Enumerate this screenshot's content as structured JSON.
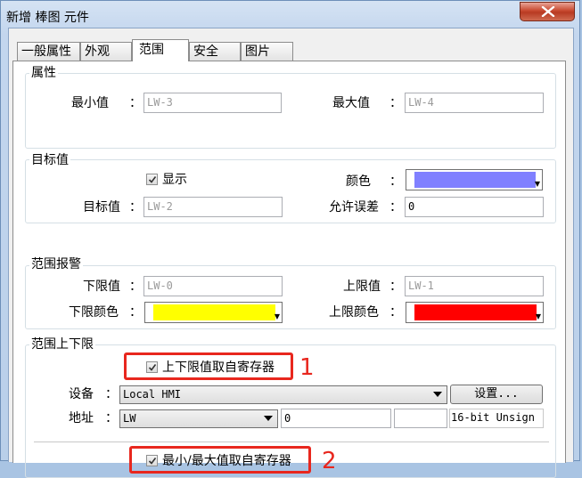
{
  "window": {
    "title": "新增 棒图 元件"
  },
  "tabs": [
    {
      "label": "一般属性"
    },
    {
      "label": "外观"
    },
    {
      "label": "范围"
    },
    {
      "label": "安全"
    },
    {
      "label": "图片"
    }
  ],
  "active_tab": "范围",
  "attributes": {
    "title": "属性",
    "min_label": "最小值",
    "min_value": "LW-3",
    "max_label": "最大值",
    "max_value": "LW-4"
  },
  "target": {
    "title": "目标值",
    "show_label": "显示",
    "show_checked": true,
    "color_label": "颜色",
    "color": "#8080ff",
    "target_label": "目标值",
    "target_value": "LW-2",
    "tolerance_label": "允许误差",
    "tolerance_value": "0"
  },
  "alarm": {
    "title": "范围报警",
    "low_label": "下限值",
    "low_value": "LW-0",
    "high_label": "上限值",
    "high_value": "LW-1",
    "low_color_label": "下限颜色",
    "low_color": "#ffff00",
    "high_color_label": "上限颜色",
    "high_color": "#ff0000"
  },
  "limits": {
    "title": "范围上下限",
    "from_register_label": "上下限值取自寄存器",
    "from_register_checked": true,
    "device_label": "设备",
    "device_value": "Local HMI",
    "settings_button": "设置...",
    "address_label": "地址",
    "address_type": "LW",
    "address_value": "0",
    "data_format": "16-bit Unsign",
    "minmax_register_label": "最小/最大值取自寄存器",
    "minmax_register_checked": true
  },
  "annotations": {
    "marker_1": "1",
    "marker_2": "2",
    "highlight_color": "#e8271e"
  },
  "colon": "："
}
